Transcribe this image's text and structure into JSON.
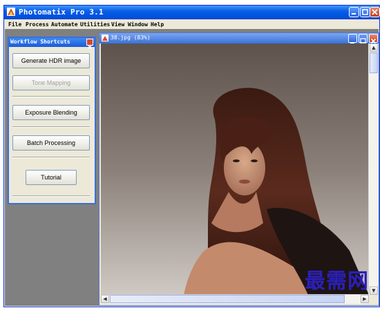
{
  "app": {
    "title": "Photomatix Pro 3.1",
    "menu": [
      "File",
      "Process",
      "Automate",
      "Utilities",
      "View",
      "Window",
      "Help"
    ]
  },
  "workflow_panel": {
    "title": "Workflow Shortcuts",
    "buttons": {
      "generate_hdr": "Generate HDR image",
      "tone_mapping": "Tone Mapping",
      "exposure_blending": "Exposure Blending",
      "batch_processing": "Batch Processing",
      "tutorial": "Tutorial"
    }
  },
  "image_window": {
    "title": "38.jpg (83%)"
  },
  "watermark": "最需网",
  "colors": {
    "titlebar": "#0054E3",
    "workspace": "#808080",
    "watermark": "#2B1FBD"
  }
}
